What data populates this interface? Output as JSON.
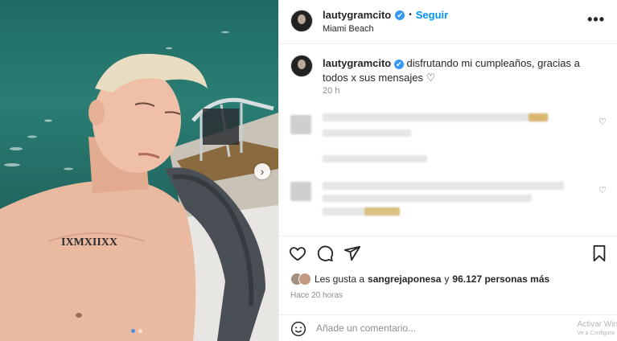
{
  "post": {
    "username": "lautygramcito",
    "verified_glyph": "✔",
    "follow_label": "Seguir",
    "separator": "•",
    "location": "Miami Beach",
    "more_label": "•••",
    "caption": "disfrutando mi cumpleaños, gracias a todos x sus mensajes ♡",
    "caption_time": "20 h"
  },
  "photo": {
    "tattoo_text": "IXMXIIXX",
    "next_arrow": "›",
    "slides": 2,
    "active_slide": 1
  },
  "actions": {
    "like_icon": "heart-icon",
    "comment_icon": "comment-icon",
    "share_icon": "share-icon",
    "save_icon": "bookmark-icon"
  },
  "likes": {
    "prefix": "Les gusta a",
    "user": "sangrejaponesa",
    "middle": "y",
    "count": "96.127 personas más"
  },
  "posted_ago": "Hace 20 horas",
  "comment_box": {
    "placeholder": "Añade un comentario..."
  },
  "comment_heart": "♡",
  "watermark": {
    "line1": "Activar Win",
    "line2": "Ve a Configura"
  }
}
